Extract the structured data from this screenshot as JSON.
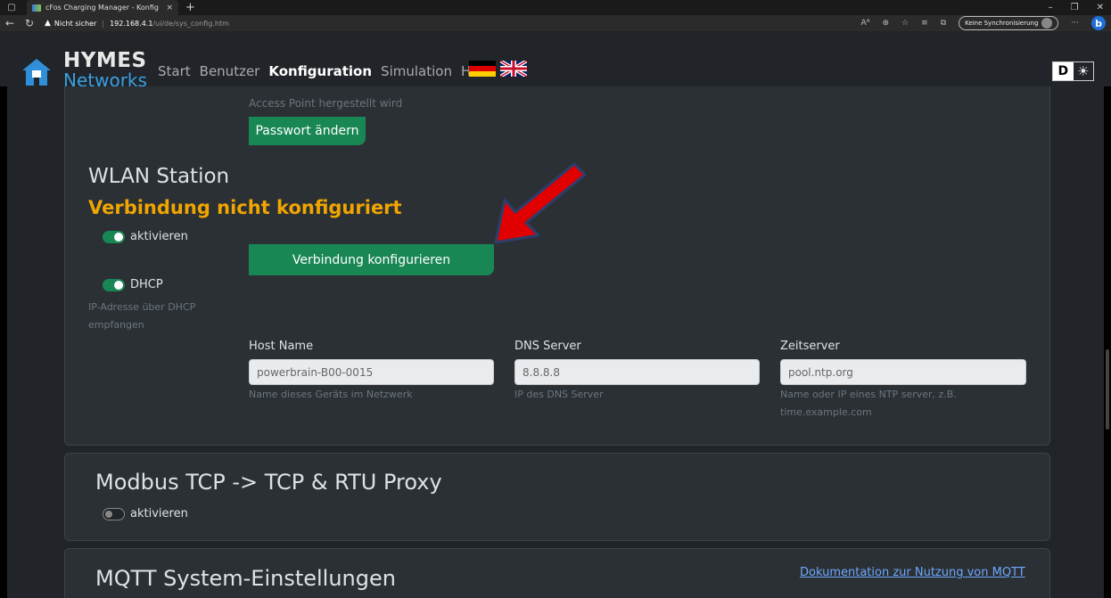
{
  "browser": {
    "tab_title": "cFos Charging Manager - Konfig",
    "close_glyph": "×",
    "new_tab_glyph": "+",
    "not_secure": "Nicht sicher",
    "url_host": "192.168.4.1",
    "url_path": "/ui/de/sys_config.htm",
    "sync_label": "Keine Synchronisierung",
    "bing_label": "b",
    "more_glyph": "···"
  },
  "navbar": {
    "brand_line1": "HYMES",
    "brand_line2": "Networks",
    "links": [
      "Start",
      "Benutzer",
      "Konfiguration",
      "Simulation",
      "Hilfe"
    ],
    "active_index": 2,
    "theme_dark_label": "D",
    "theme_light_glyph": "☀"
  },
  "access_point": {
    "hint_text": "Access Point hergestellt wird",
    "change_password_button": "Passwort ändern"
  },
  "wlan_station": {
    "heading": "WLAN Station",
    "status_text": "Verbindung nicht konfiguriert",
    "status_color": "#f0a500",
    "activate_label": "aktivieren",
    "activate_on": true,
    "configure_button": "Verbindung konfigurieren",
    "dhcp_label": "DHCP",
    "dhcp_on": true,
    "dhcp_hint_line1": "IP-Adresse über DHCP",
    "dhcp_hint_line2": "empfangen",
    "host_name_label": "Host Name",
    "host_name_value": "powerbrain-B00-0015",
    "host_name_hint": "Name dieses Geräts im Netzwerk",
    "dns_label": "DNS Server",
    "dns_value": "8.8.8.8",
    "dns_hint": "IP des DNS Server",
    "time_label": "Zeitserver",
    "time_value": "pool.ntp.org",
    "time_hint_line1": "Name oder IP eines NTP server, z.B.",
    "time_hint_line2": "time.example.com"
  },
  "modbus": {
    "heading": "Modbus TCP -> TCP & RTU Proxy",
    "activate_label": "aktivieren",
    "activate_on": false
  },
  "mqtt": {
    "heading": "MQTT System-Einstellungen",
    "doc_link": "Dokumentation zur Nutzung von MQTT"
  },
  "colors": {
    "accent_green": "#198754",
    "arrow_red": "#e00000",
    "link_blue": "#6ea8fe"
  }
}
